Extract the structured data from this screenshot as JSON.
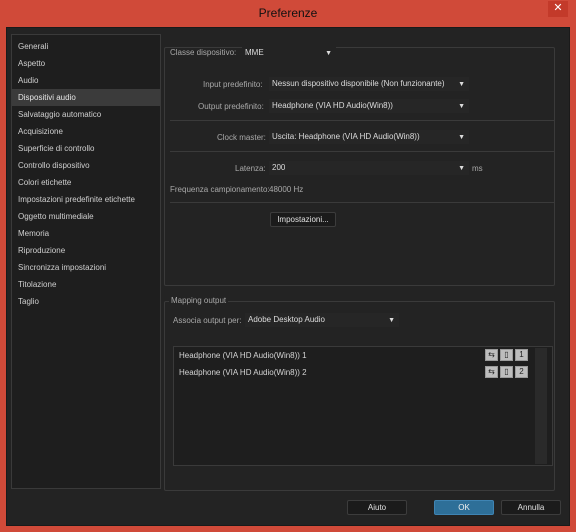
{
  "window": {
    "title": "Preferenze",
    "close_glyph": "✕"
  },
  "sidebar": {
    "items": [
      {
        "label": "Generali"
      },
      {
        "label": "Aspetto"
      },
      {
        "label": "Audio"
      },
      {
        "label": "Dispositivi audio"
      },
      {
        "label": "Salvataggio automatico"
      },
      {
        "label": "Acquisizione"
      },
      {
        "label": "Superficie di controllo"
      },
      {
        "label": "Controllo dispositivo"
      },
      {
        "label": "Colori etichette"
      },
      {
        "label": "Impostazioni predefinite etichette"
      },
      {
        "label": "Oggetto multimediale"
      },
      {
        "label": "Memoria"
      },
      {
        "label": "Riproduzione"
      },
      {
        "label": "Sincronizza impostazioni"
      },
      {
        "label": "Titolazione"
      },
      {
        "label": "Taglio"
      }
    ],
    "selected": "Dispositivi audio"
  },
  "device": {
    "class_label": "Classe dispositivo:",
    "class_value": "MME",
    "input_label": "Input predefinito:",
    "input_value": "Nessun dispositivo disponibile (Non funzionante)",
    "output_label": "Output predefinito:",
    "output_value": "Headphone (VIA HD Audio(Win8))",
    "clock_label": "Clock master:",
    "clock_value": "Uscita: Headphone (VIA HD Audio(Win8))",
    "latency_label": "Latenza:",
    "latency_value": "200",
    "latency_unit": "ms",
    "sample_rate_label": "Frequenza campionamento:",
    "sample_rate_value": "48000 Hz",
    "settings_button": "Impostazioni..."
  },
  "mapping": {
    "group_title": "Mapping output",
    "assoc_label": "Associa output per:",
    "assoc_value": "Adobe Desktop Audio",
    "outputs": [
      {
        "label": "Headphone (VIA HD Audio(Win8)) 1",
        "channel": "1"
      },
      {
        "label": "Headphone (VIA HD Audio(Win8)) 2",
        "channel": "2"
      }
    ]
  },
  "footer": {
    "help": "Aiuto",
    "ok": "OK",
    "cancel": "Annulla"
  }
}
